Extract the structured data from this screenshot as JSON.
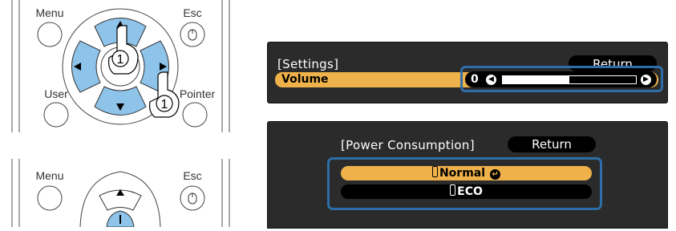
{
  "remote_top": {
    "menu_label": "Menu",
    "esc_label": "Esc",
    "user_label": "User",
    "pointer_label": "Pointer",
    "step_up": "1",
    "step_right": "1",
    "arrow_up_icon": "triangle-up-icon",
    "arrow_down_icon": "triangle-down-icon",
    "arrow_left_icon": "triangle-left-icon",
    "arrow_right_icon": "triangle-right-icon"
  },
  "remote_bottom": {
    "menu_label": "Menu",
    "esc_label": "Esc"
  },
  "settings_panel": {
    "title": "[Settings]",
    "return_label": "Return",
    "volume_label": "Volume",
    "volume_value": "0",
    "volume_level_fraction": 0.5
  },
  "power_panel": {
    "title": "[Power Consumption]",
    "return_label": "Return",
    "options": [
      {
        "label": "Normal",
        "selected": true
      },
      {
        "label": "ECO",
        "selected": false
      }
    ]
  },
  "colors": {
    "highlight_blue": "#2e6ea8",
    "button_blue": "#8ec3ea",
    "menu_bg": "#2b2b2b",
    "selected_row": "#efb24a"
  }
}
